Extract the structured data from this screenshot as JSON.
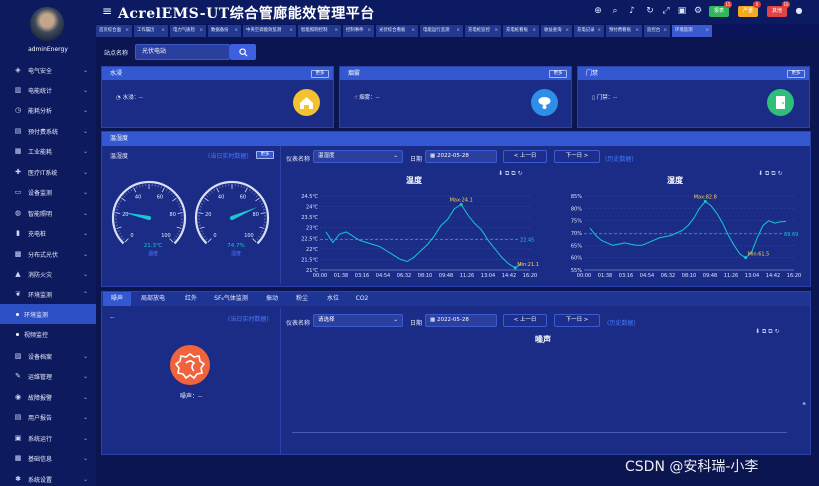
{
  "user": {
    "name": "adminEnergy"
  },
  "sidebar": {
    "items": [
      {
        "label": "电气安全",
        "icon": "shield-icon",
        "top": 60
      },
      {
        "label": "电能统计",
        "icon": "bar-chart-icon",
        "top": 80
      },
      {
        "label": "能耗分析",
        "icon": "analysis-icon",
        "top": 100
      },
      {
        "label": "预付费系统",
        "icon": "wallet-icon",
        "top": 121
      },
      {
        "label": "工业能耗",
        "icon": "factory-icon",
        "top": 141
      },
      {
        "label": "医疗IT系统",
        "icon": "medical-icon",
        "top": 162
      },
      {
        "label": "设备监测",
        "icon": "monitor-icon",
        "top": 182
      },
      {
        "label": "智能照明",
        "icon": "bulb-icon",
        "top": 203
      },
      {
        "label": "充电桩",
        "icon": "charger-icon",
        "top": 223
      },
      {
        "label": "分布式光伏",
        "icon": "solar-icon",
        "top": 244
      },
      {
        "label": "消防火灾",
        "icon": "fire-extinguisher-icon",
        "top": 264
      },
      {
        "label": "环境监测",
        "icon": "environment-icon",
        "top": 284
      },
      {
        "label": "设备档案",
        "icon": "archive-icon",
        "top": 346
      },
      {
        "label": "运维管理",
        "icon": "maintenance-icon",
        "top": 366
      },
      {
        "label": "故障报警",
        "icon": "alarm-icon",
        "top": 387
      },
      {
        "label": "用户报告",
        "icon": "report-icon",
        "top": 407
      },
      {
        "label": "系统运行",
        "icon": "system-run-icon",
        "top": 428
      },
      {
        "label": "基础信息",
        "icon": "info-icon",
        "top": 448
      },
      {
        "label": "系统设置",
        "icon": "settings-icon",
        "top": 469
      }
    ],
    "subitems": [
      {
        "label": "环境监测",
        "active": true,
        "top": 304
      },
      {
        "label": "视频监控",
        "active": false,
        "top": 324
      }
    ]
  },
  "header": {
    "title": "AcrelEMS-UT综合管廊能效管理平台",
    "badges": [
      {
        "label": "报表",
        "count": "15",
        "color": "#2fb85a"
      },
      {
        "label": "严重",
        "count": "0",
        "color": "#f2a91e"
      },
      {
        "label": "其他",
        "count": "10",
        "color": "#e04444"
      }
    ]
  },
  "tabs": [
    "首页综合面",
    "工作履历",
    "电力气质检",
    "数据备份",
    "中央空调能效监测",
    "智能照明控制",
    "控制事件",
    "光伏综合看板",
    "电能运行监测",
    "充电桩监控",
    "充电桩看板",
    "收益查询",
    "充电记录",
    "预付费看板",
    "监控台",
    "环境监测"
  ],
  "search": {
    "label": "站点名称",
    "value": "光伏电站"
  },
  "cards": [
    {
      "title": "水浸",
      "more": "更多",
      "stat": "水浸：--",
      "icon": "house-water-icon",
      "color": "#f2c231"
    },
    {
      "title": "烟雾",
      "more": "更多",
      "stat": "烟雾：--",
      "icon": "smoke-detector-icon",
      "color": "#2f8fe8"
    },
    {
      "title": "门禁",
      "more": "更多",
      "stat": "门禁：--",
      "icon": "door-icon",
      "color": "#2fbf7a"
    }
  ],
  "temp_section": {
    "title": "温湿度",
    "left_label": "温湿度",
    "realtime_link": "(当日实时数据)",
    "more": "更多",
    "gauges": [
      {
        "value_text": "21.3℃",
        "label": "温度",
        "value": 21.3
      },
      {
        "value_text": "74.7%",
        "label": "湿度",
        "value": 74.7
      }
    ],
    "gauge_ticks": [
      "0",
      "20",
      "40",
      "60",
      "80",
      "100"
    ],
    "device_label": "仪表名称",
    "device_value": "温湿度",
    "date_label": "日期",
    "date_value": "2022-05-28",
    "prev": "< 上一日",
    "next": "下一日 >",
    "history_link": "(历史数据)"
  },
  "chart_data": [
    {
      "type": "line",
      "title": "温度",
      "x": [
        "00:00",
        "01:38",
        "03:16",
        "04:54",
        "06:32",
        "08:10",
        "09:48",
        "11:26",
        "13:04",
        "14:42",
        "16:20"
      ],
      "y_ticks": [
        "21℃",
        "21.5℃",
        "22℃",
        "22.5℃",
        "23℃",
        "23.5℃",
        "24℃",
        "24.5℃"
      ],
      "ylim": [
        21,
        24.5
      ],
      "series": [
        {
          "values": [
            22.8,
            22.3,
            22.7,
            22.8,
            22.6,
            22.4,
            22.3,
            22.2,
            22.1,
            21.9,
            21.7,
            21.5,
            21.4,
            21.6,
            21.9,
            22.2,
            22.6,
            23.1,
            23.4,
            23.9,
            24.1,
            23.6,
            23.2,
            22.9,
            22.4,
            22.0,
            21.6,
            21.3,
            21.1,
            21.3
          ]
        }
      ],
      "annotations": {
        "max": "Max:24.1",
        "min": "Min:21.1",
        "avg": "22.45"
      },
      "color": "#19c7d0"
    },
    {
      "type": "line",
      "title": "湿度",
      "x": [
        "00:00",
        "01:38",
        "03:16",
        "04:54",
        "06:32",
        "08:10",
        "09:48",
        "11:26",
        "13:04",
        "14:42",
        "16:20"
      ],
      "y_ticks": [
        "55%",
        "60%",
        "65%",
        "70%",
        "75%",
        "80%",
        "85%"
      ],
      "ylim": [
        55,
        85
      ],
      "series": [
        {
          "values": [
            72,
            69,
            67,
            66,
            65,
            65.5,
            66,
            65.5,
            65,
            65,
            66,
            67,
            68,
            68.5,
            69,
            70,
            71,
            73,
            76,
            80,
            82.8,
            81,
            78,
            74,
            69,
            65,
            61.5,
            60,
            62,
            68,
            73,
            75,
            74,
            74.5,
            74.7
          ]
        }
      ],
      "annotations": {
        "max": "Max:82.8",
        "min": "Min:61.5",
        "avg": "69.69"
      },
      "color": "#19c7d0"
    }
  ],
  "sub_tabs": [
    "噪声",
    "局部放电",
    "红外",
    "SF₆气体监测",
    "振动",
    "粉尘",
    "水位",
    "CO2"
  ],
  "noise_section": {
    "dash": "--",
    "realtime_link": "(当日实时数据)",
    "stat": "噪声：--",
    "device_label": "仪表名称",
    "device_value": "请选择",
    "date_label": "日期",
    "date_value": "2022-05-28",
    "prev": "< 上一日",
    "next": "下一日 >",
    "history_link": "(历史数据)",
    "chart_title": "噪声"
  },
  "watermark": "CSDN @安科瑞-小李"
}
